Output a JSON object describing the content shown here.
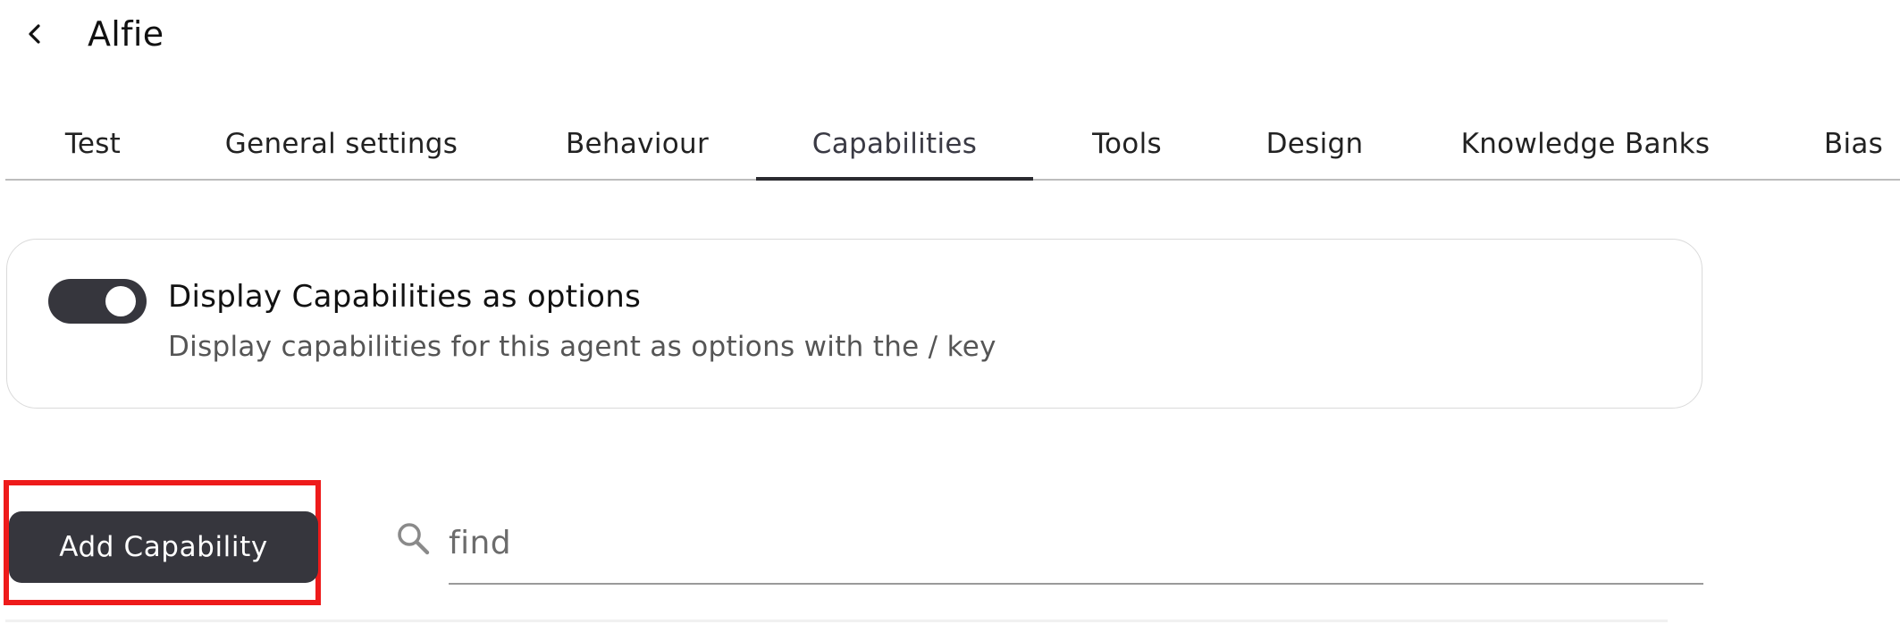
{
  "header": {
    "title": "Alfie",
    "back_icon": "chevron-left-icon"
  },
  "tabs": [
    {
      "label": "Test",
      "active": false
    },
    {
      "label": "General settings",
      "active": false
    },
    {
      "label": "Behaviour",
      "active": false
    },
    {
      "label": "Capabilities",
      "active": true
    },
    {
      "label": "Tools",
      "active": false
    },
    {
      "label": "Design",
      "active": false
    },
    {
      "label": "Knowledge Banks",
      "active": false
    },
    {
      "label": "Bias",
      "active": false
    }
  ],
  "settings_card": {
    "toggle_on": true,
    "title": "Display Capabilities as options",
    "description": "Display capabilities for this agent as options with the / key"
  },
  "actions": {
    "add_button_label": "Add Capability"
  },
  "search": {
    "icon": "search-icon",
    "placeholder": "find",
    "value": ""
  },
  "colors": {
    "accent_dark": "#36363d",
    "highlight": "#ee1b1b",
    "tab_underline": "#2b2b30"
  }
}
